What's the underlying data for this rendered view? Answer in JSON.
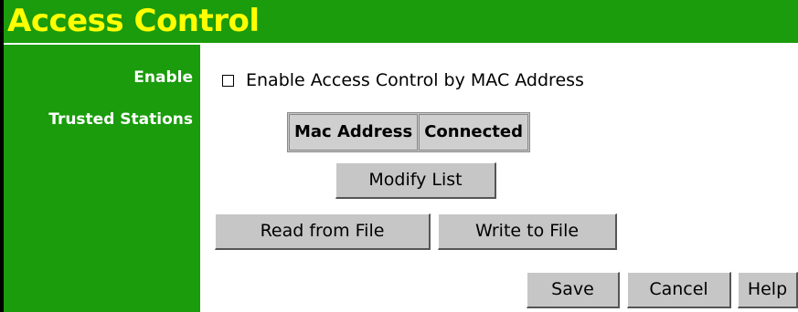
{
  "page": {
    "title": "Access Control"
  },
  "sidebar": {
    "enable_label": "Enable",
    "trusted_label": "Trusted Stations"
  },
  "enable": {
    "checked": false,
    "label": "Enable Access Control by MAC Address"
  },
  "table": {
    "headers": [
      "Mac Address",
      "Connected"
    ],
    "rows": []
  },
  "buttons": {
    "modify_list": "Modify List",
    "read_from_file": "Read from File",
    "write_to_file": "Write to File",
    "save": "Save",
    "cancel": "Cancel",
    "help": "Help"
  },
  "colors": {
    "header_green": "#1a9c0c",
    "title_yellow": "#ffff00",
    "button_gray": "#c6c6c6"
  }
}
